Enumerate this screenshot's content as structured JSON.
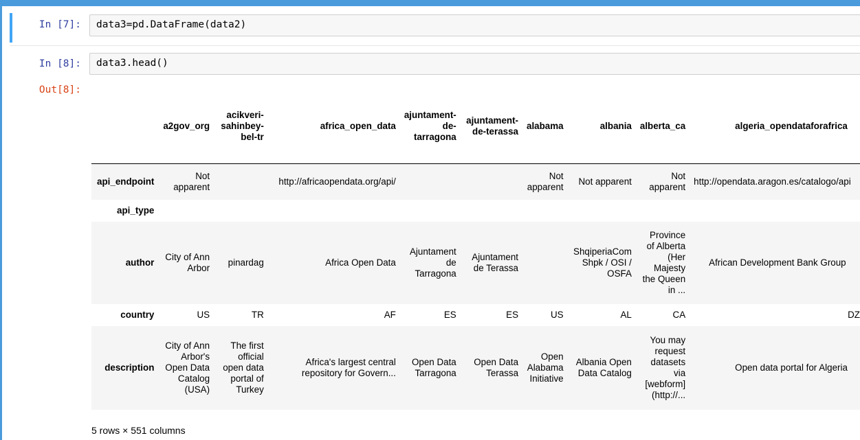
{
  "cells": [
    {
      "prompt": "In [7]:",
      "code": "data3=pd.DataFrame(data2)"
    },
    {
      "prompt": "In [8]:",
      "code": "data3.head()"
    }
  ],
  "output": {
    "prompt": "Out[8]:",
    "columns": [
      "a2gov_org",
      "acikveri-sahinbey-bel-tr",
      "africa_open_data",
      "ajuntament-de-tarragona",
      "ajuntament-de-terassa",
      "alabama",
      "albania",
      "alberta_ca",
      "algeria_opendataforafrica"
    ],
    "rows": [
      {
        "index": "api_endpoint",
        "cells": [
          "Not apparent",
          "",
          "http://africaopendata.org/api/",
          "",
          "",
          "Not apparent",
          "Not apparent",
          "Not apparent",
          "http://opendata.aragon.es/catalogo/api"
        ]
      },
      {
        "index": "api_type",
        "cells": [
          "",
          "",
          "",
          "",
          "",
          "",
          "",
          "",
          ""
        ]
      },
      {
        "index": "author",
        "cells": [
          "City of Ann Arbor",
          "pinardag",
          "Africa Open Data",
          "Ajuntament de Tarragona",
          "Ajuntament de Terassa",
          "",
          "ShqiperiaCom Shpk / OSI / OSFA",
          "Province of Alberta (Her Majesty the Queen in ...",
          "African Development Bank Group"
        ]
      },
      {
        "index": "country",
        "cells": [
          "US",
          "TR",
          "AF",
          "ES",
          "ES",
          "US",
          "AL",
          "CA",
          "DZ"
        ]
      },
      {
        "index": "description",
        "cells": [
          "City of Ann Arbor's Open Data Catalog (USA)",
          "The first official open data portal of Turkey",
          "Africa's largest central repository for Govern...",
          "Open Data Tarragona",
          "Open Data Terassa",
          "Open Alabama Initiative",
          "Albania Open Data Catalog",
          "You may request datasets via [webform] (http://...",
          "Open data portal for Algeria"
        ]
      }
    ],
    "footer": "5 rows × 551 columns"
  }
}
